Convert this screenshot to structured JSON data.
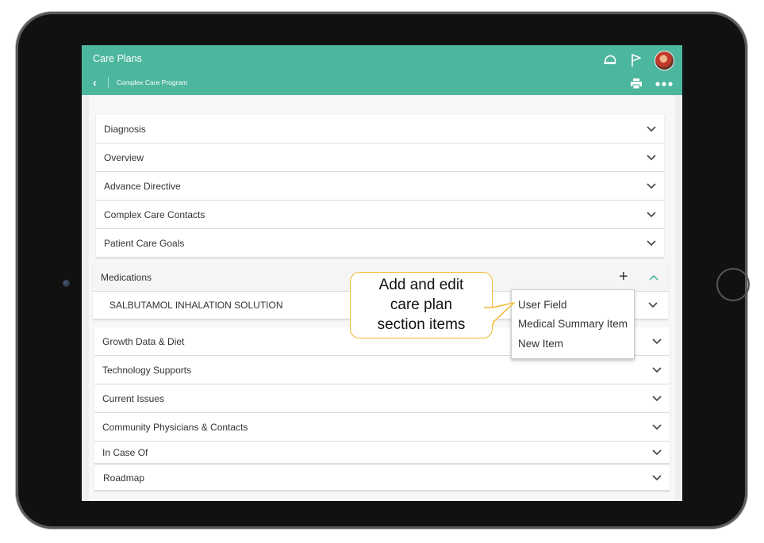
{
  "app": {
    "title": "Care Plans",
    "breadcrumb": "Complex Care Program",
    "accent_color": "#4db69e"
  },
  "top_icons": [
    "helmet-icon",
    "flag-icon",
    "avatar",
    "print-icon",
    "more-icon"
  ],
  "sections_top": [
    {
      "label": "Diagnosis"
    },
    {
      "label": "Overview"
    },
    {
      "label": "Advance Directive"
    },
    {
      "label": "Complex Care Contacts"
    },
    {
      "label": "Patient Care Goals"
    }
  ],
  "medications": {
    "label": "Medications",
    "items": [
      {
        "label": "SALBUTAMOL INHALATION SOLUTION"
      }
    ]
  },
  "sections_bottom": [
    {
      "label": "Growth Data & Diet"
    },
    {
      "label": "Technology Supports"
    },
    {
      "label": "Current Issues"
    },
    {
      "label": "Community Physicians & Contacts"
    },
    {
      "label": "In Case Of"
    },
    {
      "label": "Roadmap"
    }
  ],
  "add_menu": {
    "items": [
      {
        "label": "User Field"
      },
      {
        "label": "Medical Summary Item"
      },
      {
        "label": "New Item"
      }
    ]
  },
  "callout": {
    "line1": "Add and edit",
    "line2": "care plan",
    "line3": "section items"
  }
}
